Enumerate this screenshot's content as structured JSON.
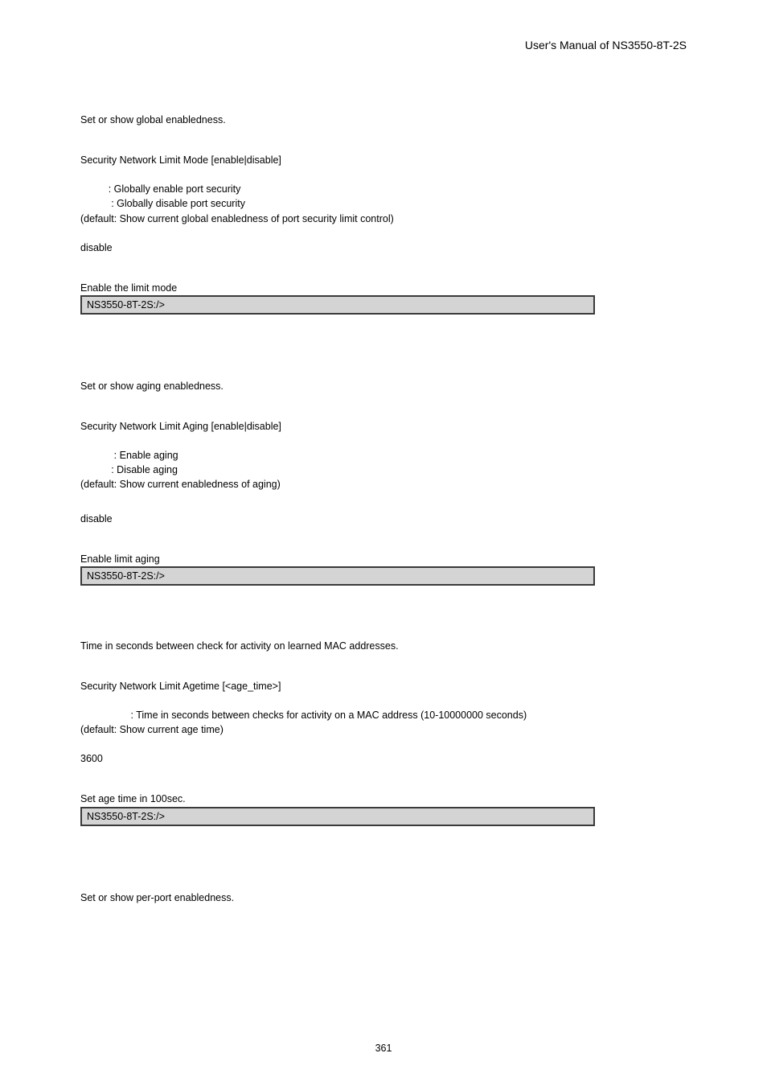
{
  "header": {
    "manual_title": "User's  Manual  of  NS3550-8T-2S"
  },
  "section1": {
    "desc": "Set or show global enabledness.",
    "syntax": "Security Network Limit Mode [enable|disable]",
    "param1": "          : Globally enable port security",
    "param2": "           : Globally disable port security",
    "param3": "(default: Show current global enabledness of port security limit control)",
    "default_val": "disable",
    "example_label": "Enable the limit mode",
    "cli": "NS3550-8T-2S:/>"
  },
  "section2": {
    "desc": "Set or show aging enabledness.",
    "syntax": "Security Network Limit Aging [enable|disable]",
    "param1": "            : Enable aging",
    "param2": "           : Disable aging",
    "param3": "(default: Show current enabledness of aging)",
    "default_val": "disable",
    "example_label": "Enable limit aging",
    "cli": "NS3550-8T-2S:/>"
  },
  "section3": {
    "desc": "Time in seconds between check for activity on learned MAC addresses.",
    "syntax": "Security Network Limit Agetime [<age_time>]",
    "param1": "                  : Time in seconds between checks for activity on a MAC address (10-10000000 seconds)",
    "param2": "(default: Show current age time)",
    "default_val": "3600",
    "example_label": "Set age time in 100sec.",
    "cli": "NS3550-8T-2S:/>"
  },
  "section4": {
    "desc": "Set or show per-port enabledness."
  },
  "page_number": "361"
}
